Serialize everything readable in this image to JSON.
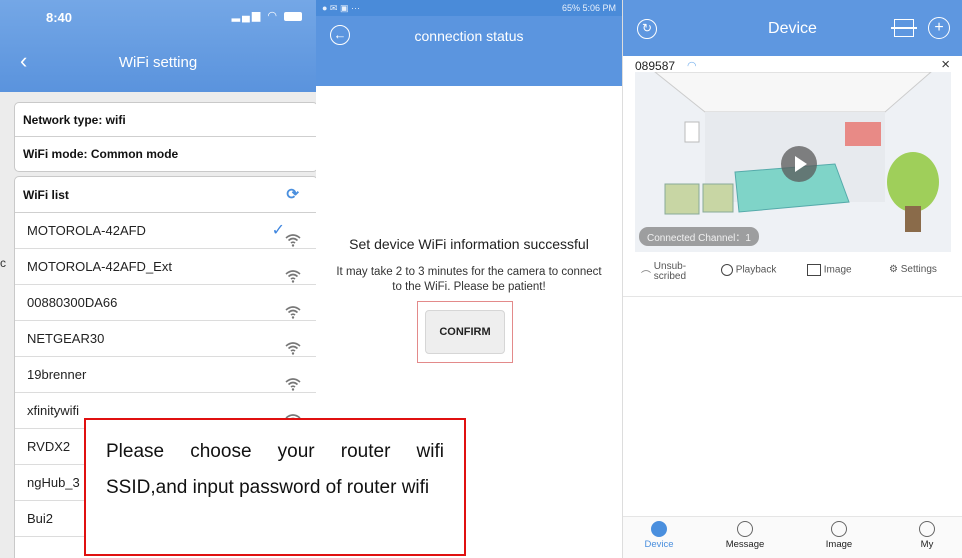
{
  "panel1": {
    "status_time": "8:40",
    "title": "WiFi setting",
    "network_type": "Network type:  wifi",
    "wifi_mode": "WiFi mode:  Common mode",
    "list_title": "WiFi list",
    "networks": [
      {
        "ssid": "MOTOROLA-42AFD",
        "selected": true
      },
      {
        "ssid": "MOTOROLA-42AFD_Ext",
        "selected": false
      },
      {
        "ssid": "00880300DA66",
        "selected": false
      },
      {
        "ssid": "NETGEAR30",
        "selected": false
      },
      {
        "ssid": "19brenner",
        "selected": false
      },
      {
        "ssid": "xfinitywifi",
        "selected": false
      },
      {
        "ssid": "RVDX2",
        "selected": false
      },
      {
        "ssid": "ngHub_3",
        "selected": false
      },
      {
        "ssid": "Bui2",
        "selected": false
      }
    ],
    "stray_char": "c"
  },
  "panel2": {
    "status_right": "65% 5:06 PM",
    "title": "connection status",
    "message": "Set device WiFi information successful",
    "sub_message": "It may take 2 to 3 minutes for the camera to connect to the WiFi. Please be patient!",
    "confirm_label": "CONFIRM"
  },
  "panel3": {
    "title": "Device",
    "device_id": "089587",
    "connection_status": "Connected  Channel：1",
    "actions": {
      "unsubscribed": "Unsub-scribed",
      "playback": "Playback",
      "image": "Image",
      "settings": "Settings"
    },
    "tabs": {
      "device": "Device",
      "message": "Message",
      "image": "Image",
      "my": "My"
    },
    "accent_color": "#5e97e0"
  },
  "callout": {
    "text": "Please choose your router wifi SSID,and input password of router wifi",
    "border_color": "#e01010"
  }
}
